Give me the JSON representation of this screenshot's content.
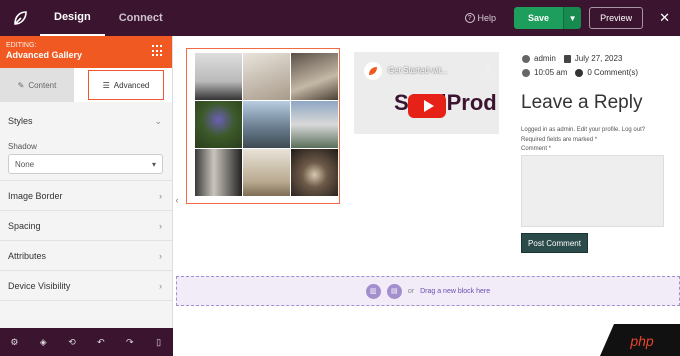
{
  "header": {
    "tabs": [
      {
        "label": "Design"
      },
      {
        "label": "Connect"
      }
    ],
    "help_label": "Help",
    "save_label": "Save",
    "preview_label": "Preview"
  },
  "sidebar": {
    "editing_label": "EDITING:",
    "block_title": "Advanced Gallery",
    "subtabs": [
      {
        "label": "Content"
      },
      {
        "label": "Advanced"
      }
    ],
    "styles_label": "Styles",
    "shadow_label": "Shadow",
    "shadow_value": "None",
    "sections": [
      {
        "label": "Image Border"
      },
      {
        "label": "Spacing"
      },
      {
        "label": "Attributes"
      },
      {
        "label": "Device Visibility"
      }
    ]
  },
  "video": {
    "title": "Get Started wit...",
    "brand_text": "SeedProd"
  },
  "post": {
    "author": "admin",
    "date": "July 27, 2023",
    "time": "10:05 am",
    "comments": "0 Comment(s)"
  },
  "reply": {
    "heading": "Leave a Reply",
    "logged_in": "Logged in as admin. Edit your profile. Log out?",
    "required": "Required fields are marked *",
    "comment_label": "Comment *",
    "submit_label": "Post Comment"
  },
  "dropzone": {
    "or_label": "or",
    "drag_label": "Drag a new block here"
  },
  "watermark": {
    "text": "php"
  },
  "colors": {
    "topbar": "#3b1430",
    "accent": "#f05a22",
    "save": "#1d9e5c",
    "dropzone": "#a38fce"
  }
}
